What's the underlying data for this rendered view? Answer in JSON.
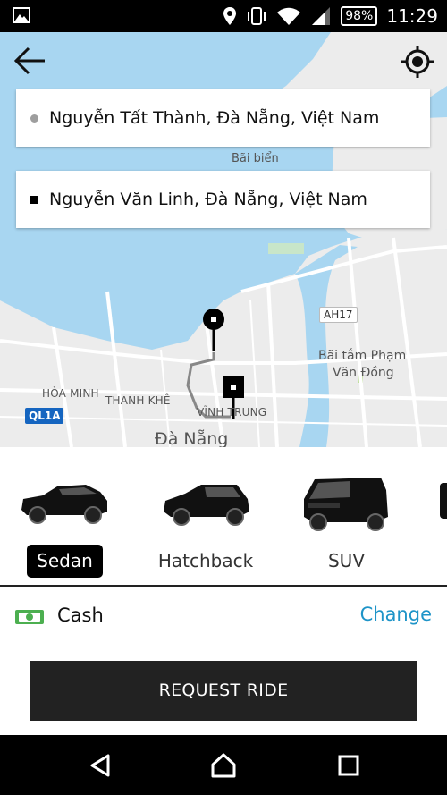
{
  "status_bar": {
    "battery": "98%",
    "time": "11:29",
    "icons": [
      "image-icon",
      "location-icon",
      "vibrate-icon",
      "wifi-icon",
      "signal-icon",
      "battery-icon"
    ]
  },
  "map": {
    "pickup_address": "Nguyễn Tất Thành, Đà Nẵng, Việt Nam",
    "destination_address": "Nguyễn Văn Linh, Đà Nẵng, Việt Nam",
    "labels": {
      "bai_bien": "Bãi biển",
      "ah17": "AH17",
      "bai_tam_line1": "Bãi tắm Phạm",
      "bai_tam_line2": "Văn Đồng",
      "hoa_minh": "HÒA MINH",
      "thanh_khe": "THANH KHÊ",
      "vinh_trung": "VĨNH TRUNG",
      "ql1a": "QL1A",
      "da_nang": "Đà Nẵng"
    },
    "colors": {
      "water": "#a8d6f1",
      "land": "#ececec",
      "route": "#888888"
    }
  },
  "vehicles": [
    {
      "label": "Sedan",
      "selected": true
    },
    {
      "label": "Hatchback",
      "selected": false
    },
    {
      "label": "SUV",
      "selected": false
    }
  ],
  "payment": {
    "method": "Cash",
    "change_label": "Change",
    "colors": {
      "cash_icon": "#4caf50",
      "link": "#1e94c8"
    }
  },
  "request_button": "REQUEST RIDE"
}
